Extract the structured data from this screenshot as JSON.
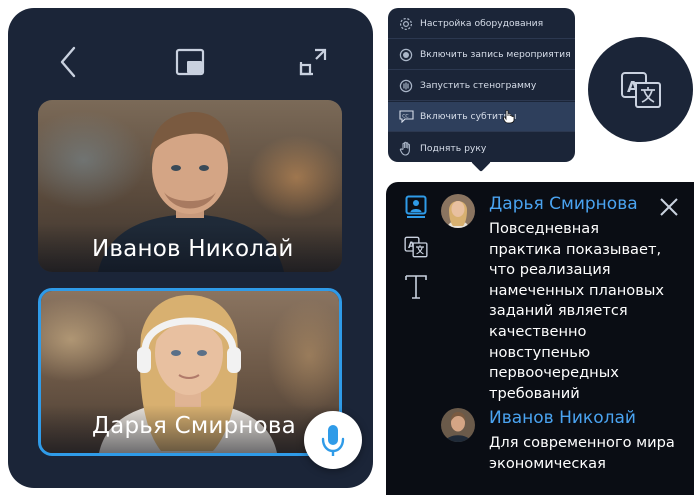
{
  "call": {
    "participants": [
      {
        "name": "Иванов Николай"
      },
      {
        "name": "Дарья Смирнова",
        "active": true
      }
    ],
    "icons": {
      "back": "chevron-left-icon",
      "pip": "picture-in-picture-icon",
      "expand": "expand-icon",
      "mic": "microphone-icon"
    }
  },
  "menu": {
    "items": [
      {
        "label": "Настройка оборудования",
        "icon": "settings-icon"
      },
      {
        "label": "Включить запись мероприятия",
        "icon": "record-icon"
      },
      {
        "label": "Запустить стенограмму",
        "icon": "transcript-icon"
      },
      {
        "label": "Включить субтитры",
        "icon": "cc-icon",
        "active": true
      },
      {
        "label": "Поднять руку",
        "icon": "hand-icon"
      }
    ]
  },
  "subtitles": {
    "messages": [
      {
        "speaker": "Дарья Смирнова",
        "text": "Повседневная практика показывает, что реализация намеченных плановых заданий является качественно новступенью первоочередных требований"
      },
      {
        "speaker": "Иванов Николай",
        "text": "Для современного мира экономическая"
      }
    ]
  },
  "colors": {
    "panel": "#1b2538",
    "accent": "#2f9be8",
    "speaker_name": "#4aa3f0",
    "subtitle_bg": "#0a0d14"
  }
}
